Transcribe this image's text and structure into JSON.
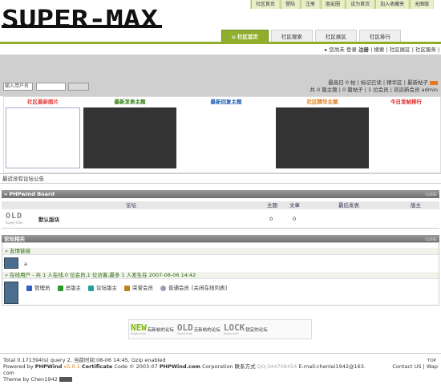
{
  "header": {
    "logo_text": "SUPER-MAX",
    "top_links": [
      "社区首页",
      "登陆",
      "注册",
      "朋友圈",
      "设为首页",
      "加入收藏夹",
      "无图版"
    ],
    "tabs": [
      "社区首页",
      "社区搜索",
      "社区展区",
      "社区排行"
    ],
    "subnav": {
      "greeting": "您尚未",
      "login": "登录",
      "register": "注册",
      "search": "搜索",
      "exhibit": "社区展区",
      "service": "社区服务",
      "help": "帮助"
    }
  },
  "login": {
    "username_placeholder": "输入用户名"
  },
  "stats": {
    "line1": "最高日 0 帖 | 标记已读 | 精华区 | 最新帖子",
    "line2": "共 0 篇主题 | 0 篇帖子 | 1 位会员 | 欢迎新会员 admin"
  },
  "blocks": [
    {
      "title": "社区最新图片",
      "color": "#e04040"
    },
    {
      "title": "最新发表主题",
      "color": "#2e7d10"
    },
    {
      "title": "最新回复主题",
      "color": "#1e5cb3"
    },
    {
      "title": "社区精华主题",
      "color": "#e07a10"
    },
    {
      "title": "今日发帖排行",
      "color": "#e02020"
    }
  ],
  "announcement": "最近没有论坛公告",
  "board": {
    "title": "PHPwind Board",
    "close": "CLOSE",
    "columns": {
      "forum": "论坛",
      "topics": "主题",
      "posts": "文章",
      "last": "最后发表",
      "mod": "版主"
    },
    "rows": [
      {
        "badge": "OLD",
        "badge_sub": "Super-max",
        "name": "默认版块",
        "topics": "0",
        "posts": "0"
      }
    ]
  },
  "related": {
    "title": "论坛相关",
    "close": "CLOSE",
    "links_title": "友情链接",
    "link_item": "a",
    "online_title": "在线用户 - 共 1 人在线,0 位会员,1 位访客,最多 1 人发生在 2007-08-06 14:42",
    "legend": [
      {
        "label": "管理员",
        "color": "#3060c0"
      },
      {
        "label": "总版主",
        "color": "#2a9a2a"
      },
      {
        "label": "论坛版主",
        "color": "#20a0a0"
      },
      {
        "label": "荣誉会员",
        "color": "#c08020"
      },
      {
        "label": "普通会员",
        "color": "#9aa0b0"
      }
    ],
    "close_online": "[关闭在线列表]"
  },
  "icon_legend": [
    {
      "big": "NEW",
      "big_color": "#7ab800",
      "sub": "Super-max",
      "text": "有新帖的论坛"
    },
    {
      "big": "OLD",
      "big_color": "#888888",
      "sub": "Super-max",
      "text": "无新帖的论坛"
    },
    {
      "big": "LOCK",
      "big_color": "#888888",
      "sub": "Super-max",
      "text": "锁定的论坛"
    }
  ],
  "footer": {
    "line1": "Total 0.171394(s) query 2, 当前时间:08-06 14:45, Gzip enabled",
    "powered": "Powered by",
    "pw": "PHPWind",
    "ver": "v5.0.1",
    "cert": "Certificate",
    "code": "Code © 2003-07",
    "site": "PHPWind.com",
    "corp": "Corporation 联系方式",
    "qq": "QQ:344708454",
    "email": "E-mail:chenlei1942@163.",
    "line3": "com",
    "theme": "Theme by Chen1942",
    "top": "TOP",
    "contact": "Contact US | Wap"
  }
}
